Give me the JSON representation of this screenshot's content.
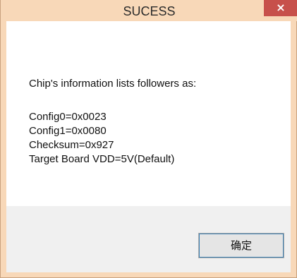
{
  "window": {
    "title": "SUCESS",
    "close_label": "×"
  },
  "content": {
    "message": "Chip's information lists followers as:",
    "lines": [
      "Config0=0x0023",
      "Config1=0x0080",
      "Checksum=0x927",
      "Target Board VDD=5V(Default)"
    ]
  },
  "footer": {
    "ok_label": "确定"
  },
  "colors": {
    "titlebar": "#f8d8b8",
    "close_button": "#c7504b",
    "footer": "#f0f0f0"
  },
  "icons": {
    "close": "close-icon"
  }
}
